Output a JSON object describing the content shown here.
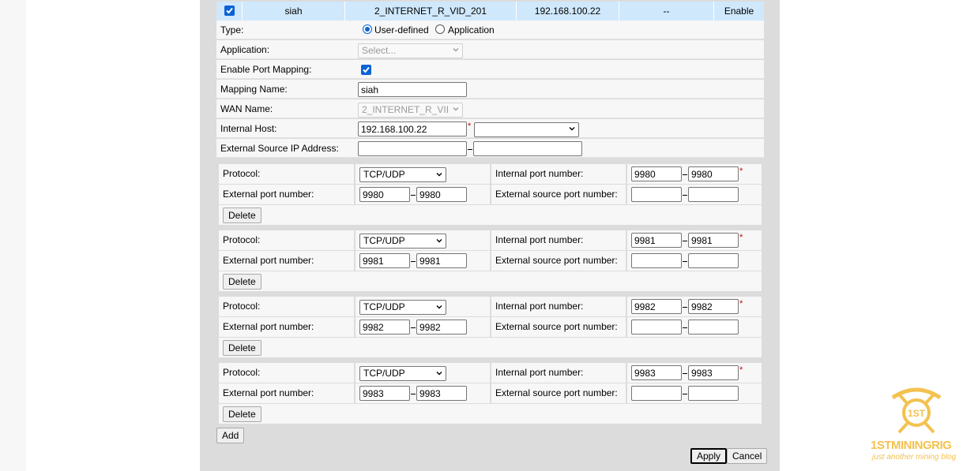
{
  "summary": {
    "checked": true,
    "name": "siah",
    "wan": "2_INTERNET_R_VID_201",
    "host": "192.168.100.22",
    "extra": "--",
    "status": "Enable"
  },
  "form": {
    "type_label": "Type:",
    "type_opt1": "User-defined",
    "type_opt2": "Application",
    "application_label": "Application:",
    "application_placeholder": "Select...",
    "enable_label": "Enable Port Mapping:",
    "mapping_label": "Mapping Name:",
    "mapping_value": "siah",
    "wan_label": "WAN Name:",
    "wan_value": "2_INTERNET_R_VII",
    "host_label": "Internal Host:",
    "host_value": "192.168.100.22",
    "ext_ip_label": "External Source IP Address:",
    "required_mark": "*"
  },
  "labels": {
    "protocol": "Protocol:",
    "internal_port": "Internal port number:",
    "external_port": "External port number:",
    "external_source_port": "External source port number:",
    "delete": "Delete"
  },
  "mappings": [
    {
      "protocol": "TCP/UDP",
      "int_start": "9980",
      "int_end": "9980",
      "ext_start": "9980",
      "ext_end": "9980"
    },
    {
      "protocol": "TCP/UDP",
      "int_start": "9981",
      "int_end": "9981",
      "ext_start": "9981",
      "ext_end": "9981"
    },
    {
      "protocol": "TCP/UDP",
      "int_start": "9982",
      "int_end": "9982",
      "ext_start": "9982",
      "ext_end": "9982"
    },
    {
      "protocol": "TCP/UDP",
      "int_start": "9983",
      "int_end": "9983",
      "ext_start": "9983",
      "ext_end": "9983"
    }
  ],
  "actions": {
    "add": "Add",
    "apply": "Apply",
    "cancel": "Cancel"
  },
  "watermark": {
    "brand": "1STMININGRIG",
    "tagline": "just another mining blog",
    "color": "#f3c24f"
  }
}
